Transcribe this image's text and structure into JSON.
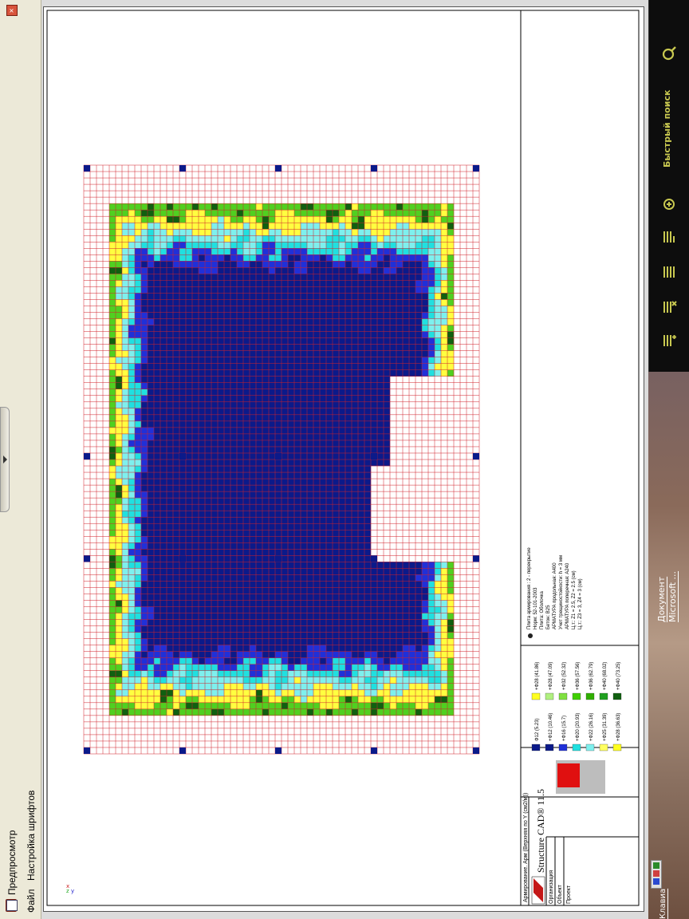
{
  "window": {
    "title": "Предпросмотр",
    "close_label": "×",
    "menu": [
      {
        "label": "Файл"
      },
      {
        "label": "Настройка шрифтов"
      }
    ]
  },
  "sidebar": {
    "search_label": "Быстрый поиск",
    "icons": [
      "search-icon",
      "zoom-in-icon",
      "list-icon",
      "list-icon",
      "list-remove-icon",
      "list-add-icon"
    ]
  },
  "taskbar": {
    "doc_label_1": "Документ",
    "doc_label_2": "Microsoft ...",
    "bottom_label": "Клавиа"
  },
  "drawing": {
    "stamp": {
      "product": "Structure CAD® 11.5",
      "caption": "Армирование. Арм (Верхняя по Y (см2/м))",
      "row_1": "Организация",
      "row_2": "Объект",
      "row_3": "Проект"
    },
    "legend": [
      {
        "label": "Ф12 (5.23)",
        "color": "#0b1a8a"
      },
      {
        "label": "+Ф12 (10.46)",
        "color": "#0b1a8a"
      },
      {
        "label": "+Ф16 (15.7)",
        "color": "#2030d8"
      },
      {
        "label": "+Ф20 (20.93)",
        "color": "#20e0e0"
      },
      {
        "label": "+Ф22 (26.16)",
        "color": "#7ef0ee"
      },
      {
        "label": "+Ф25 (31.39)",
        "color": "#ffff60"
      },
      {
        "label": "+Ф28 (36.63)",
        "color": "#ffff20"
      },
      {
        "label": "+Ф28 (41.86)",
        "color": "#ffff20"
      },
      {
        "label": "+Ф28 (47.09)",
        "color": "#b0f080"
      },
      {
        "label": "+Ф32 (52.32)",
        "color": "#80e040"
      },
      {
        "label": "+Ф36 (57.56)",
        "color": "#40d000"
      },
      {
        "label": "+Ф36 (62.79)",
        "color": "#30b000"
      },
      {
        "label": "+Ф40 (68.02)",
        "color": "#20a020"
      },
      {
        "label": "+Ф40 (73.25)",
        "color": "#106010"
      }
    ],
    "notes": [
      "Плита армирования : 2 - перекрытие",
      "Норм: 52-101-2003",
      "Плита: Оболочка",
      "Бетон: В25",
      "АРМАТУРА продольная: А400",
      "Учет трещиностойкости: h = 3 мм",
      "АРМАТУРА поперечная: А240",
      "Ц.т.: Z1 = 2.5, Z2 = 2.5 (см)",
      "Ц.т.: Z3 = 3, Z4 = 3 (см)"
    ]
  },
  "chart_data": {
    "type": "heatmap",
    "title": "",
    "legend": [
      "Ф12 (5.23)",
      "+Ф12 (10.46)",
      "+Ф16 (15.7)",
      "+Ф20 (20.93)",
      "+Ф22 (26.16)",
      "+Ф25 (31.39)",
      "+Ф28 (36.63)",
      "+Ф28 (41.86)",
      "+Ф28 (47.09)",
      "+Ф32 (52.32)",
      "+Ф36 (57.56)",
      "+Ф36 (62.79)",
      "+Ф40 (68.02)",
      "+Ф40 (73.25)"
    ],
    "grid": true,
    "colors": {
      "deep_blue": "#0b1a8a",
      "blue": "#2030d8",
      "cyan": "#20e0e0",
      "light_cyan": "#7ef0ee",
      "yellow": "#ffff40",
      "green": "#50d020",
      "dark_green": "#106010",
      "grid_red": "#d0202a"
    }
  }
}
